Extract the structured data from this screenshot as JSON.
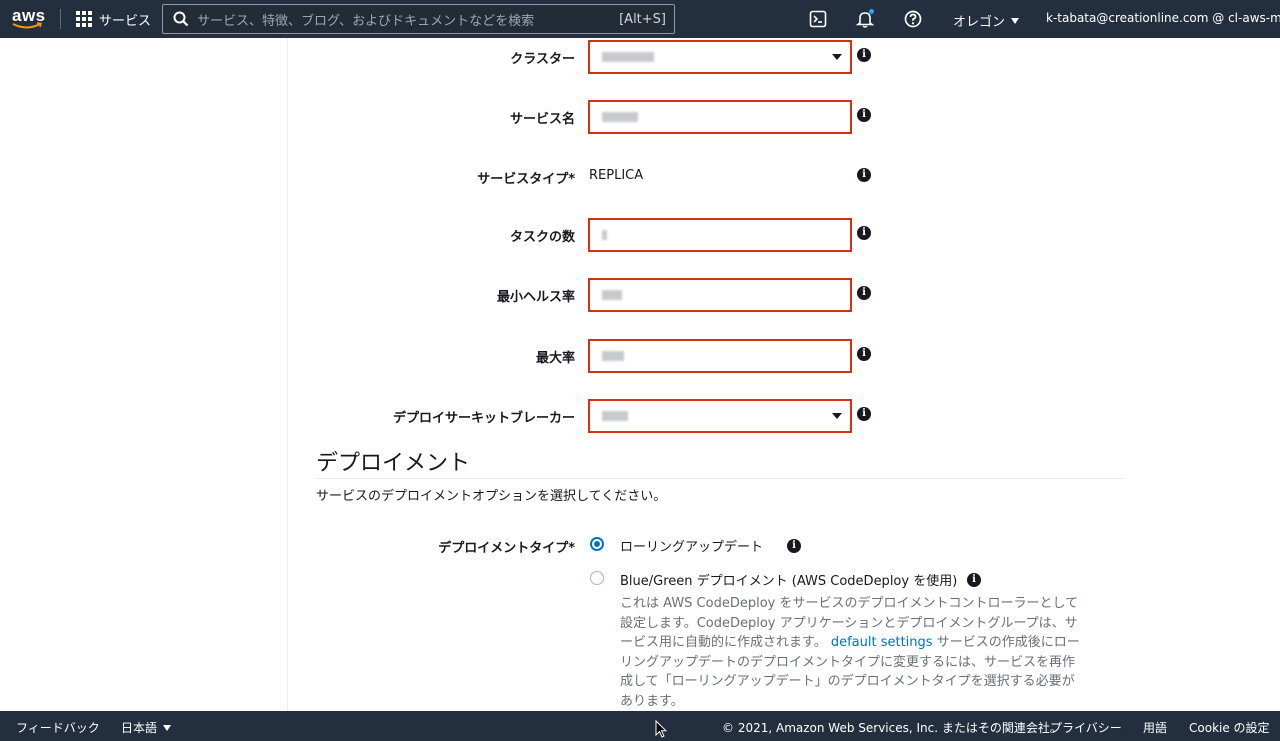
{
  "nav": {
    "logo": "aws",
    "services_label": "サービス",
    "search_placeholder": "サービス、特徴、ブログ、およびドキュメントなどを検索",
    "search_shortcut": "[Alt+S]",
    "region": "オレゴン",
    "account": "k-tabata@creationline.com @ cl-aws-ml",
    "icons": [
      "cloudshell-icon",
      "bell-icon",
      "help-icon"
    ]
  },
  "form": {
    "cluster_label": "クラスター",
    "service_name_label": "サービス名",
    "service_type_label": "サービスタイプ*",
    "service_type_value": "REPLICA",
    "task_count_label": "タスクの数",
    "min_health_label": "最小ヘルス率",
    "max_percent_label": "最大率",
    "circuit_breaker_label": "デプロイサーキットブレーカー"
  },
  "deployment": {
    "title": "デプロイメント",
    "description": "サービスのデプロイメントオプションを選択してください。",
    "type_label": "デプロイメントタイプ*",
    "options": [
      {
        "label": "ローリングアップデート",
        "selected": true
      },
      {
        "label": "Blue/Green デプロイメント (AWS CodeDeploy を使用)",
        "selected": false
      }
    ],
    "bg_desc_part1": "これは AWS CodeDeploy をサービスのデプロイメントコントローラーとして設定します。CodeDeploy アプリケーションとデプロイメントグループは、サービス用に自動的に作成されます。",
    "bg_desc_link": "default settings",
    "bg_desc_part2": "サービスの作成後にローリングアップデートのデプロイメントタイプに変更するには、サービスを再作成して「ローリングアップデート」のデプロイメントタイプを選択する必要があります。"
  },
  "footer": {
    "feedback": "フィードバック",
    "language": "日本語",
    "copyright": "© 2021, Amazon Web Services, Inc. またはその関連会社。",
    "privacy": "プライバシー",
    "terms": "用語",
    "cookie": "Cookie の設定"
  },
  "colors": {
    "nav_bg": "#232f3e",
    "highlight_border": "#d13212",
    "link": "#0073bb"
  }
}
